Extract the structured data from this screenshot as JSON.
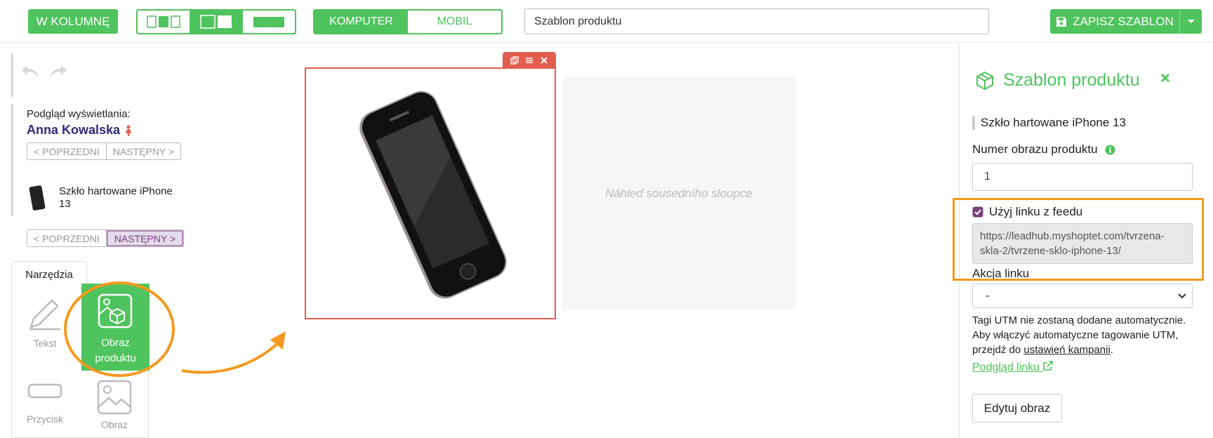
{
  "topbar": {
    "column_button": "W KOLUMNĘ",
    "device_tabs": [
      "KOMPUTER",
      "MOBIL"
    ],
    "template_name": "Szablon produktu",
    "save_button": "ZAPISZ SZABLON"
  },
  "left": {
    "preview_label": "Podgląd wyświetlania:",
    "preview_user": "Anna Kowalska",
    "prev_label": "< POPRZEDNI",
    "next_label": "NASTĘPNY >",
    "product_name": "Szkło hartowane iPhone 13",
    "tools_tab": "Narzędzia",
    "tools": [
      {
        "label": "Tekst",
        "icon": "pencil-icon"
      },
      {
        "label": "Obraz produktu",
        "icon": "product-image-icon"
      },
      {
        "label": "Przycisk",
        "icon": "button-icon"
      },
      {
        "label": "Obraz",
        "icon": "image-icon"
      }
    ]
  },
  "canvas": {
    "neighbor_placeholder": "Náhled sousedního sloupce"
  },
  "right": {
    "title": "Szablon produktu",
    "product_name": "Szkło hartowane iPhone 13",
    "image_number_label": "Numer obrazu produktu",
    "image_number_value": "1",
    "use_feed_link_label": "Użyj linku z feedu",
    "use_feed_link_checked": true,
    "feed_link": "https://leadhub.myshoptet.com/tvrzena-skla-2/tvrzene-sklo-iphone-13/",
    "link_action_label": "Akcja linku",
    "link_action_value": "-",
    "utm_text_1": "Tagi UTM nie zostaną dodane automatycznie. Aby włączyć automatyczne tagowanie UTM, przejdź do ",
    "utm_link": "ustawień kampanii",
    "utm_text_2": ".",
    "preview_link": "Podgląd linku",
    "edit_image_button": "Edytuj obraz"
  },
  "colors": {
    "green": "#4fc35d",
    "highlight_orange": "#f29a1f",
    "selection_red": "#e35d4f",
    "purple": "#7b3f7e"
  }
}
